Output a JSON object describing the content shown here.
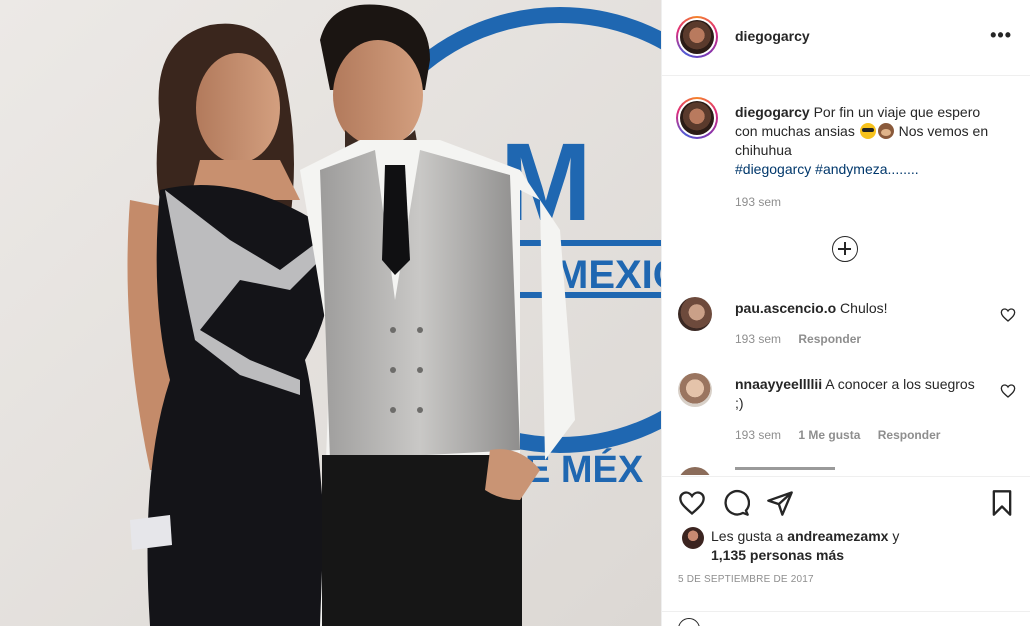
{
  "post": {
    "username": "diegogarcy",
    "more_icon": "more-horizontal-icon",
    "photo": {
      "backdrop_text_1": "MEXIC",
      "backdrop_text_2": "E MÉX",
      "backdrop_logo": "M"
    },
    "caption": {
      "username": "diegogarcy",
      "text_1": "Por fin un viaje que espero con muchas ansias",
      "text_2": "Nos vemos en chihuhua",
      "tags": "#diegogarcy #andymeza........",
      "time": "193 sem"
    },
    "comments": [
      {
        "username": "pau.ascencio.o",
        "text": "Chulos!",
        "time": "193 sem",
        "likes": "",
        "reply": "Responder"
      },
      {
        "username": "nnaayyeellllii",
        "text": "A conocer a los suegros ;)",
        "time": "193 sem",
        "likes": "1 Me gusta",
        "reply": "Responder"
      }
    ],
    "likes": {
      "prefix": "Les gusta a",
      "user": "andreamezamx",
      "conj": "y",
      "count": "1,135 personas más"
    },
    "date": "5 de septiembre de 2017"
  },
  "colors": {
    "link": "#00376b",
    "muted": "#8e8e8e",
    "text": "#262626",
    "border": "#efefef",
    "backdrop_blue": "#1f67b1"
  }
}
